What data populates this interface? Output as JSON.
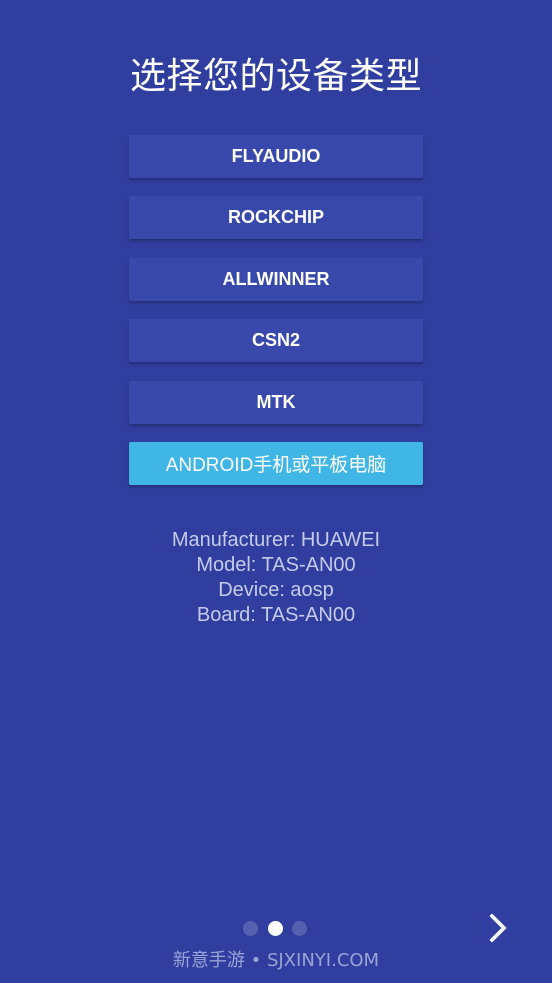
{
  "colors": {
    "background": "#303F9F",
    "button": "#3949AB",
    "button_selected": "#40B6E6",
    "text": "#FFFFFF",
    "info_text": "#C5CAE9",
    "watermark": "#9AA3D6"
  },
  "title": "选择您的设备类型",
  "device_buttons": [
    {
      "label": "FLYAUDIO",
      "selected": false
    },
    {
      "label": "ROCKCHIP",
      "selected": false
    },
    {
      "label": "ALLWINNER",
      "selected": false
    },
    {
      "label": "CSN2",
      "selected": false
    },
    {
      "label": "MTK",
      "selected": false
    },
    {
      "label": "ANDROID手机或平板电脑",
      "selected": true
    }
  ],
  "device_info": {
    "manufacturer": "Manufacturer: HUAWEI",
    "model": "Model: TAS-AN00",
    "device": "Device: aosp",
    "board": "Board: TAS-AN00"
  },
  "pager": {
    "page_count": 3,
    "active_index": 1
  },
  "next_button": {
    "icon": "chevron-right-icon"
  },
  "watermark": "新意手游 • SJXINYI.COM"
}
